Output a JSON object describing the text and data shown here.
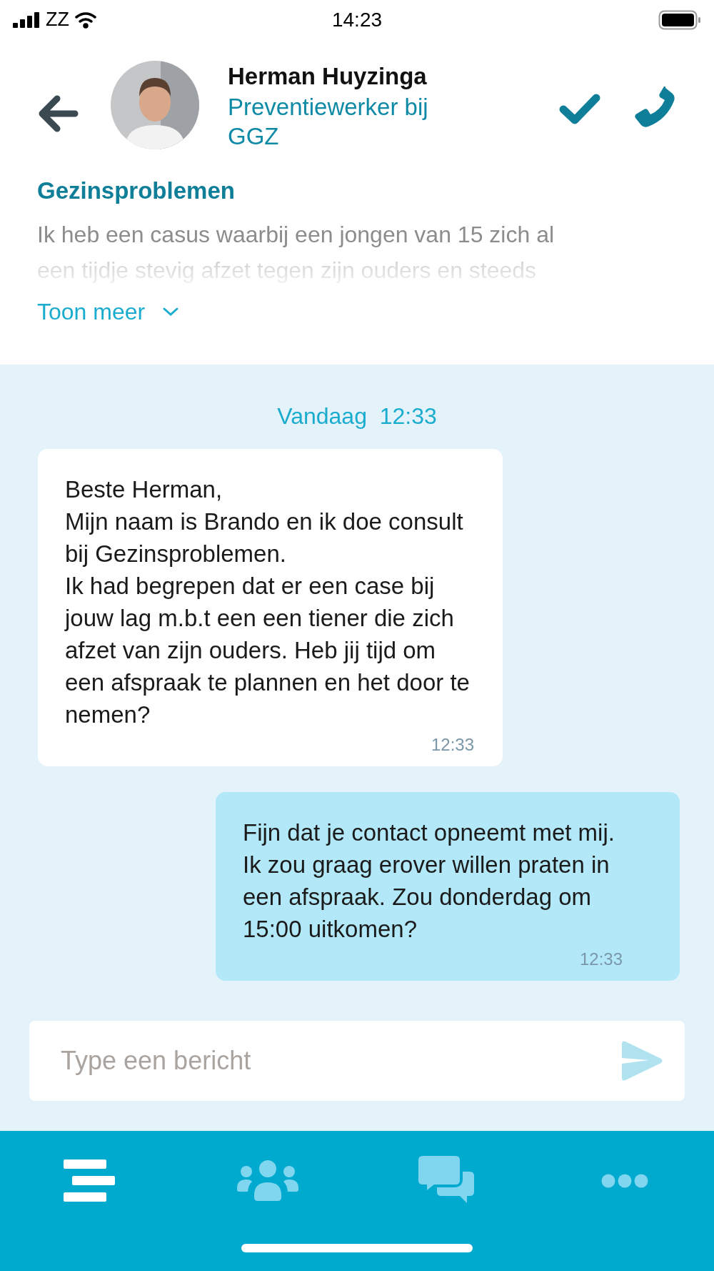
{
  "status_bar": {
    "carrier": "ZZ",
    "time": "14:23"
  },
  "header": {
    "name": "Herman Huyzinga",
    "subtitle": "Preventiewerker bij GGZ"
  },
  "topic": {
    "title": "Gezinsproblemen",
    "preview_lines": [
      "Ik heb een casus waarbij een jongen van 15 zich al",
      "een tijdje stevig afzet tegen zijn ouders en steeds"
    ],
    "more_link": "Toon meer"
  },
  "chat": {
    "date_label": "Vandaag  12:33",
    "messages": [
      {
        "kind": "received",
        "text": "Beste Herman,\nMijn naam is Brando en ik doe consult bij Gezinsproblemen.\nIk had begrepen dat er een case bij jouw lag m.b.t een een tiener die zich afzet van zijn ouders. Heb jij tijd om een afspraak te plannen en het door te nemen?",
        "time": "12:33"
      },
      {
        "kind": "sent",
        "text": "Fijn dat je contact opneemt met mij. Ik zou graag erover willen praten in een afspraak. Zou donderdag om 15:00 uitkomen?",
        "time": "12:33"
      }
    ]
  },
  "composer": {
    "placeholder": "Type een bericht"
  },
  "nav": [
    {
      "kind": "feed",
      "selected": true
    },
    {
      "kind": "groups",
      "selected": false
    },
    {
      "kind": "chats",
      "selected": false
    },
    {
      "kind": "more",
      "selected": false
    }
  ]
}
